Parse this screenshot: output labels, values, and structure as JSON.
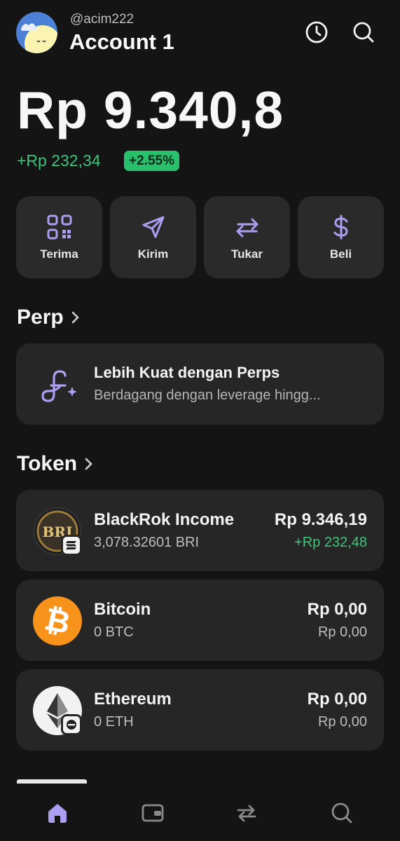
{
  "header": {
    "handle": "@acim222",
    "account_name": "Account 1",
    "icons": [
      "history-icon",
      "search-icon"
    ]
  },
  "portfolio": {
    "balance": "Rp 9.340,8",
    "change_amount": "+Rp 232,34",
    "change_percent": "+2.55%"
  },
  "actions": [
    {
      "label": "Terima",
      "icon": "qr-code-icon"
    },
    {
      "label": "Kirim",
      "icon": "send-icon"
    },
    {
      "label": "Tukar",
      "icon": "swap-icon"
    },
    {
      "label": "Beli",
      "icon": "dollar-icon"
    }
  ],
  "perp": {
    "section_title": "Perp",
    "card_title": "Lebih Kuat dengan Perps",
    "card_subtitle": "Berdagang dengan leverage hingg..."
  },
  "tokens": {
    "section_title": "Token",
    "items": [
      {
        "name": "BlackRok Income",
        "amount": "3,078.32601 BRI",
        "value": "Rp 9.346,19",
        "change": "+Rp 232,48",
        "change_positive": true,
        "logo_text": "BRI"
      },
      {
        "name": "Bitcoin",
        "amount": "0 BTC",
        "value": "Rp 0,00",
        "change": "Rp 0,00",
        "change_positive": false,
        "logo_text": "₿"
      },
      {
        "name": "Ethereum",
        "amount": "0 ETH",
        "value": "Rp 0,00",
        "change": "Rp 0,00",
        "change_positive": false
      }
    ]
  },
  "nav": {
    "items": [
      "home-icon",
      "wallet-icon",
      "swap-icon",
      "search-icon"
    ],
    "active": "home-icon"
  },
  "colors": {
    "background": "#141414",
    "card": "#262626",
    "accent": "#ab9ff2",
    "positive": "#3ec57a"
  }
}
